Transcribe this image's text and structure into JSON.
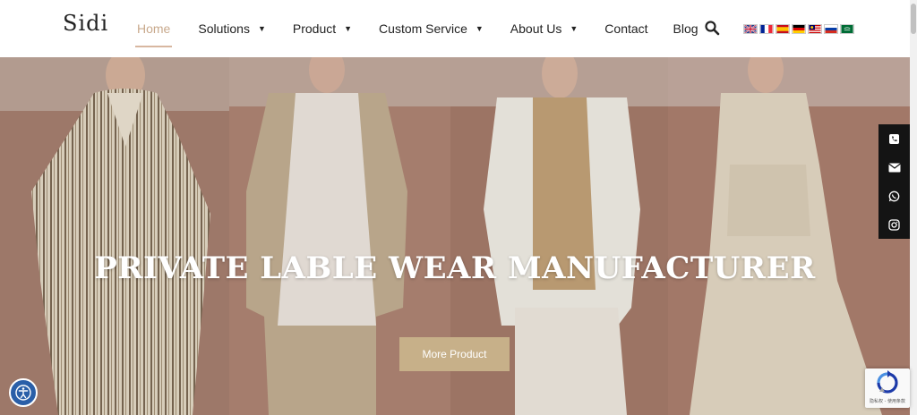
{
  "brand": {
    "logo_text": "Sidi"
  },
  "nav": {
    "items": [
      {
        "label": "Home",
        "active": true,
        "dropdown": false
      },
      {
        "label": "Solutions",
        "active": false,
        "dropdown": true
      },
      {
        "label": "Product",
        "active": false,
        "dropdown": true
      },
      {
        "label": "Custom Service",
        "active": false,
        "dropdown": true
      },
      {
        "label": "About Us",
        "active": false,
        "dropdown": true
      },
      {
        "label": "Contact",
        "active": false,
        "dropdown": false
      },
      {
        "label": "Blog",
        "active": false,
        "dropdown": false
      }
    ],
    "search_icon": "search-icon",
    "languages": [
      "en-uk",
      "fr",
      "es",
      "de",
      "ms",
      "ru",
      "ar"
    ]
  },
  "hero": {
    "title": "PRIVATE LABLE WEAR MANUFACTURER",
    "button_label": "More Product"
  },
  "side_contact": {
    "items": [
      {
        "icon": "phone-icon"
      },
      {
        "icon": "email-icon"
      },
      {
        "icon": "whatsapp-icon"
      },
      {
        "icon": "instagram-icon"
      }
    ]
  },
  "recaptcha": {
    "text": "隐私权 - 使用条款"
  },
  "colors": {
    "accent": "#c7b089",
    "nav_active": "#c8a98c",
    "side_bar": "#141414",
    "accessibility": "#2a5fa8"
  }
}
